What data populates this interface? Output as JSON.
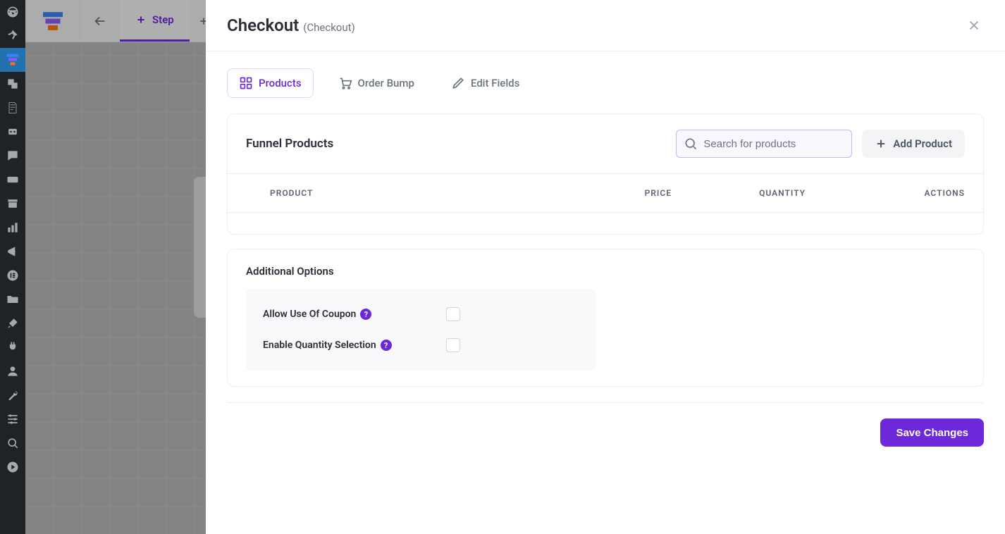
{
  "header": {
    "title": "Checkout",
    "subtitle": "(Checkout)"
  },
  "topbar": {
    "tab_label": "Step"
  },
  "tabs": {
    "products": "Products",
    "order_bump": "Order Bump",
    "edit_fields": "Edit Fields"
  },
  "products_card": {
    "title": "Funnel Products",
    "search_placeholder": "Search for products",
    "add_button": "Add Product",
    "columns": {
      "product": "PRODUCT",
      "price": "PRICE",
      "quantity": "QUANTITY",
      "actions": "ACTIONS"
    }
  },
  "options": {
    "title": "Additional Options",
    "rows": [
      {
        "label": "Allow Use Of Coupon"
      },
      {
        "label": "Enable Quantity Selection"
      }
    ]
  },
  "footer": {
    "save": "Save Changes"
  },
  "colors": {
    "primary": "#6d28d9"
  }
}
